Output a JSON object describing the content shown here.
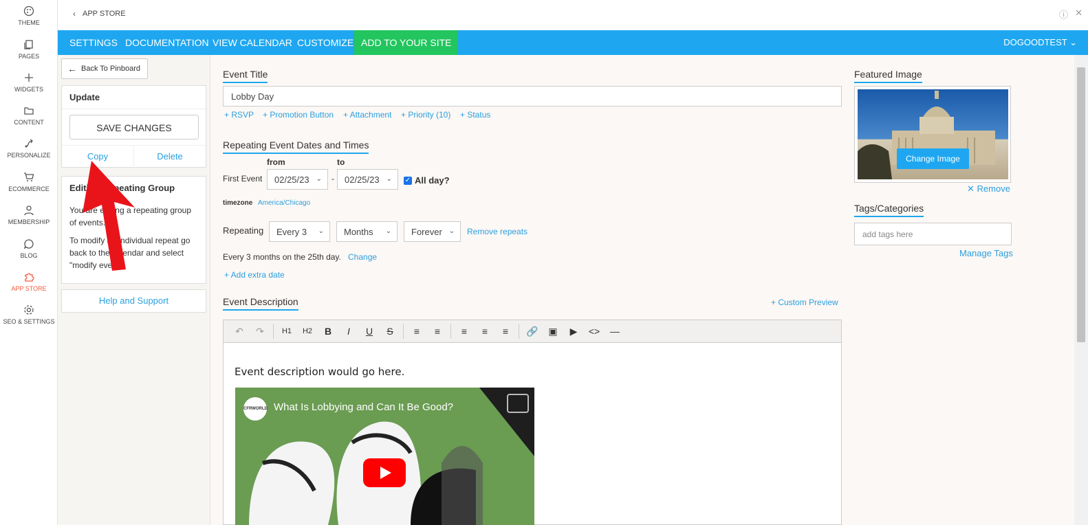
{
  "rail": [
    {
      "label": "THEME",
      "icon": "palette-icon"
    },
    {
      "label": "PAGES",
      "icon": "pages-icon"
    },
    {
      "label": "WIDGETS",
      "icon": "plus-icon"
    },
    {
      "label": "CONTENT",
      "icon": "folder-icon"
    },
    {
      "label": "PERSONALIZE",
      "icon": "personalize-icon"
    },
    {
      "label": "ECOMMERCE",
      "icon": "cart-icon"
    },
    {
      "label": "MEMBERSHIP",
      "icon": "user-icon"
    },
    {
      "label": "BLOG",
      "icon": "chat-icon"
    },
    {
      "label": "APP STORE",
      "icon": "puzzle-icon",
      "active": true
    },
    {
      "label": "SEO & SETTINGS",
      "icon": "gear-icon"
    }
  ],
  "topbar": {
    "crumb": "APP STORE"
  },
  "nav": {
    "items": [
      "SETTINGS",
      "DOCUMENTATION",
      "VIEW CALENDAR",
      "CUSTOMIZE",
      "ADD TO YOUR SITE"
    ],
    "user": "DOGOODTEST"
  },
  "left": {
    "back": "Back To Pinboard",
    "update_title": "Update",
    "save": "SAVE CHANGES",
    "copy": "Copy",
    "delete": "Delete",
    "editing_title": "Editing Repeating Group",
    "editing_p1": "You are editing a repeating group of events.",
    "editing_p2": "To modify an individual repeat go back to the calendar and select \"modify event\"",
    "help": "Help and Support"
  },
  "event": {
    "title_label": "Event Title",
    "title_value": "Lobby Day",
    "extras": [
      "+ RSVP",
      "+ Promotion Button",
      "+ Attachment",
      "+ Priority (10)",
      "+ Status"
    ],
    "dates_label": "Repeating Event Dates and Times",
    "from": "from",
    "to": "to",
    "first_event": "First Event",
    "from_date": "02/25/23",
    "to_date": "02/25/23",
    "all_day": "All day?",
    "timezone_label": "timezone",
    "timezone_value": "America/Chicago",
    "repeating_label": "Repeating",
    "every": "Every 3",
    "unit": "Months",
    "until": "Forever",
    "remove_repeats": "Remove repeats",
    "summary": "Every 3 months on the 25th day.",
    "change": "Change",
    "add_extra_date": "+ Add extra date",
    "desc_label": "Event Description",
    "custom_preview": "+ Custom Preview",
    "desc_text": "Event description would go here.",
    "video_title": "What Is Lobbying and Can It Be Good?",
    "video_channel": "CFRWORLD"
  },
  "right": {
    "featured_label": "Featured Image",
    "change_image": "Change Image",
    "remove": "Remove",
    "tags_label": "Tags/Categories",
    "tags_placeholder": "add tags here",
    "manage_tags": "Manage Tags"
  },
  "colors": {
    "nav": "#1ea7f0",
    "accent_green": "#22c55e",
    "link": "#2a9fe0",
    "active": "#f05a3a",
    "arrow": "#e8141a"
  }
}
